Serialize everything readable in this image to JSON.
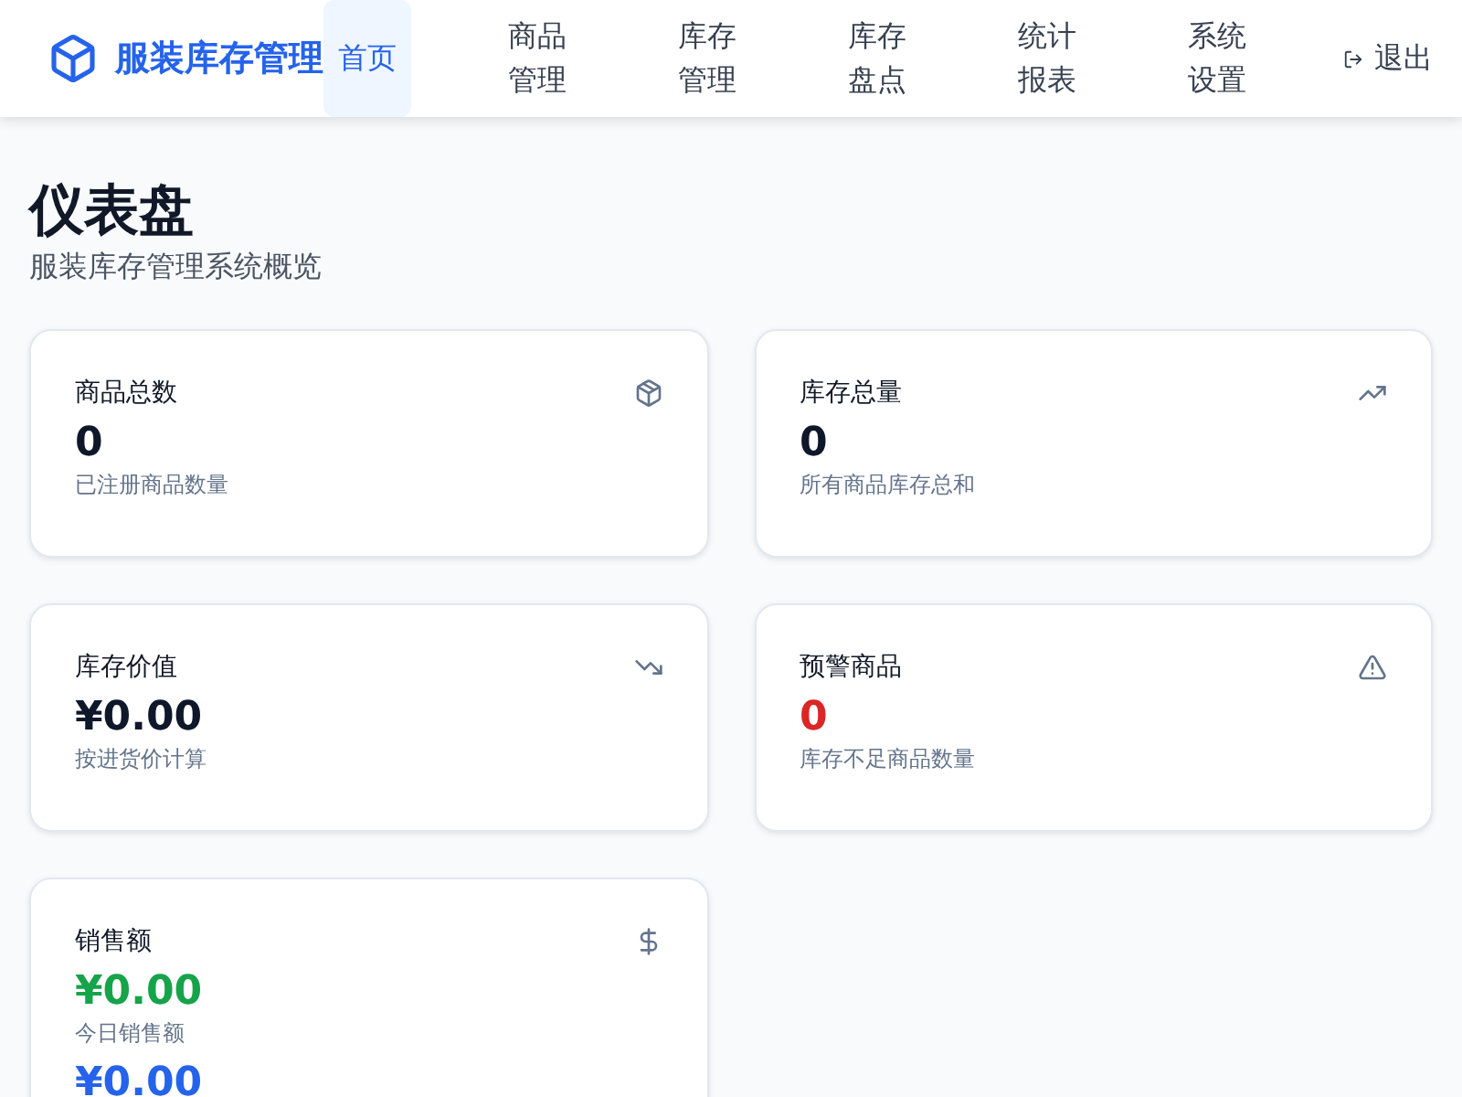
{
  "header": {
    "brand": "服装库存管理",
    "nav": [
      {
        "label": "首页",
        "selected": true
      },
      {
        "label": "商品管理",
        "selected": false
      },
      {
        "label": "库存管理",
        "selected": false
      },
      {
        "label": "库存盘点",
        "selected": false
      },
      {
        "label": "统计报表",
        "selected": false
      },
      {
        "label": "系统设置",
        "selected": false
      }
    ],
    "logout": "退出"
  },
  "page": {
    "title": "仪表盘",
    "subtitle": "服装库存管理系统概览"
  },
  "cards": [
    {
      "title": "商品总数",
      "metrics": [
        {
          "value": "0",
          "color": "#0f172a",
          "note": "已注册商品数量"
        }
      ]
    },
    {
      "title": "库存总量",
      "metrics": [
        {
          "value": "0",
          "color": "#0f172a",
          "note": "所有商品库存总和"
        }
      ]
    },
    {
      "title": "库存价值",
      "metrics": [
        {
          "value": "¥0.00",
          "color": "#0f172a",
          "note": "按进货价计算"
        }
      ]
    },
    {
      "title": "预警商品",
      "metrics": [
        {
          "value": "0",
          "color": "#dc2626",
          "note": "库存不足商品数量"
        }
      ]
    },
    {
      "title": "销售额",
      "metrics": [
        {
          "value": "¥0.00",
          "color": "#16a34a",
          "note": "今日销售额"
        },
        {
          "value": "¥0.00",
          "color": "#2563eb"
        }
      ]
    }
  ]
}
